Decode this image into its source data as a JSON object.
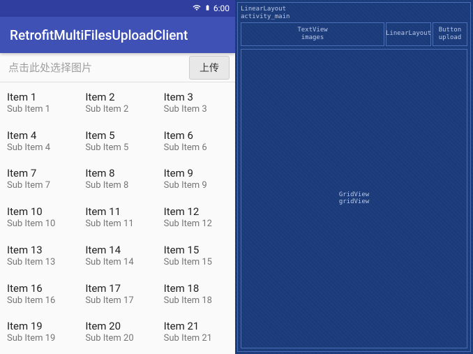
{
  "status": {
    "time": "6:00"
  },
  "appbar": {
    "title": "RetrofitMultiFilesUploadClient"
  },
  "selector": {
    "hint": "点击此处选择图片",
    "upload_label": "上传"
  },
  "grid": {
    "items": [
      {
        "title": "Item 1",
        "sub": "Sub Item 1"
      },
      {
        "title": "Item 2",
        "sub": "Sub Item 2"
      },
      {
        "title": "Item 3",
        "sub": "Sub Item 3"
      },
      {
        "title": "Item 4",
        "sub": "Sub Item 4"
      },
      {
        "title": "Item 5",
        "sub": "Sub Item 5"
      },
      {
        "title": "Item 6",
        "sub": "Sub Item 6"
      },
      {
        "title": "Item 7",
        "sub": "Sub Item 7"
      },
      {
        "title": "Item 8",
        "sub": "Sub Item 8"
      },
      {
        "title": "Item 9",
        "sub": "Sub Item 9"
      },
      {
        "title": "Item 10",
        "sub": "Sub Item 10"
      },
      {
        "title": "Item 11",
        "sub": "Sub Item 11"
      },
      {
        "title": "Item 12",
        "sub": "Sub Item 12"
      },
      {
        "title": "Item 13",
        "sub": "Sub Item 13"
      },
      {
        "title": "Item 14",
        "sub": "Sub Item 14"
      },
      {
        "title": "Item 15",
        "sub": "Sub Item 15"
      },
      {
        "title": "Item 16",
        "sub": "Sub Item 16"
      },
      {
        "title": "Item 17",
        "sub": "Sub Item 17"
      },
      {
        "title": "Item 18",
        "sub": "Sub Item 18"
      },
      {
        "title": "Item 19",
        "sub": "Sub Item 19"
      },
      {
        "title": "Item 20",
        "sub": "Sub Item 20"
      },
      {
        "title": "Item 21",
        "sub": "Sub Item 21"
      }
    ]
  },
  "blueprint": {
    "root": "LinearLayout\nactivity_main",
    "textview": "TextView\nimages",
    "linear": "LinearLayout",
    "button": "Button\nupload",
    "gridview": "GridView\ngridView"
  }
}
